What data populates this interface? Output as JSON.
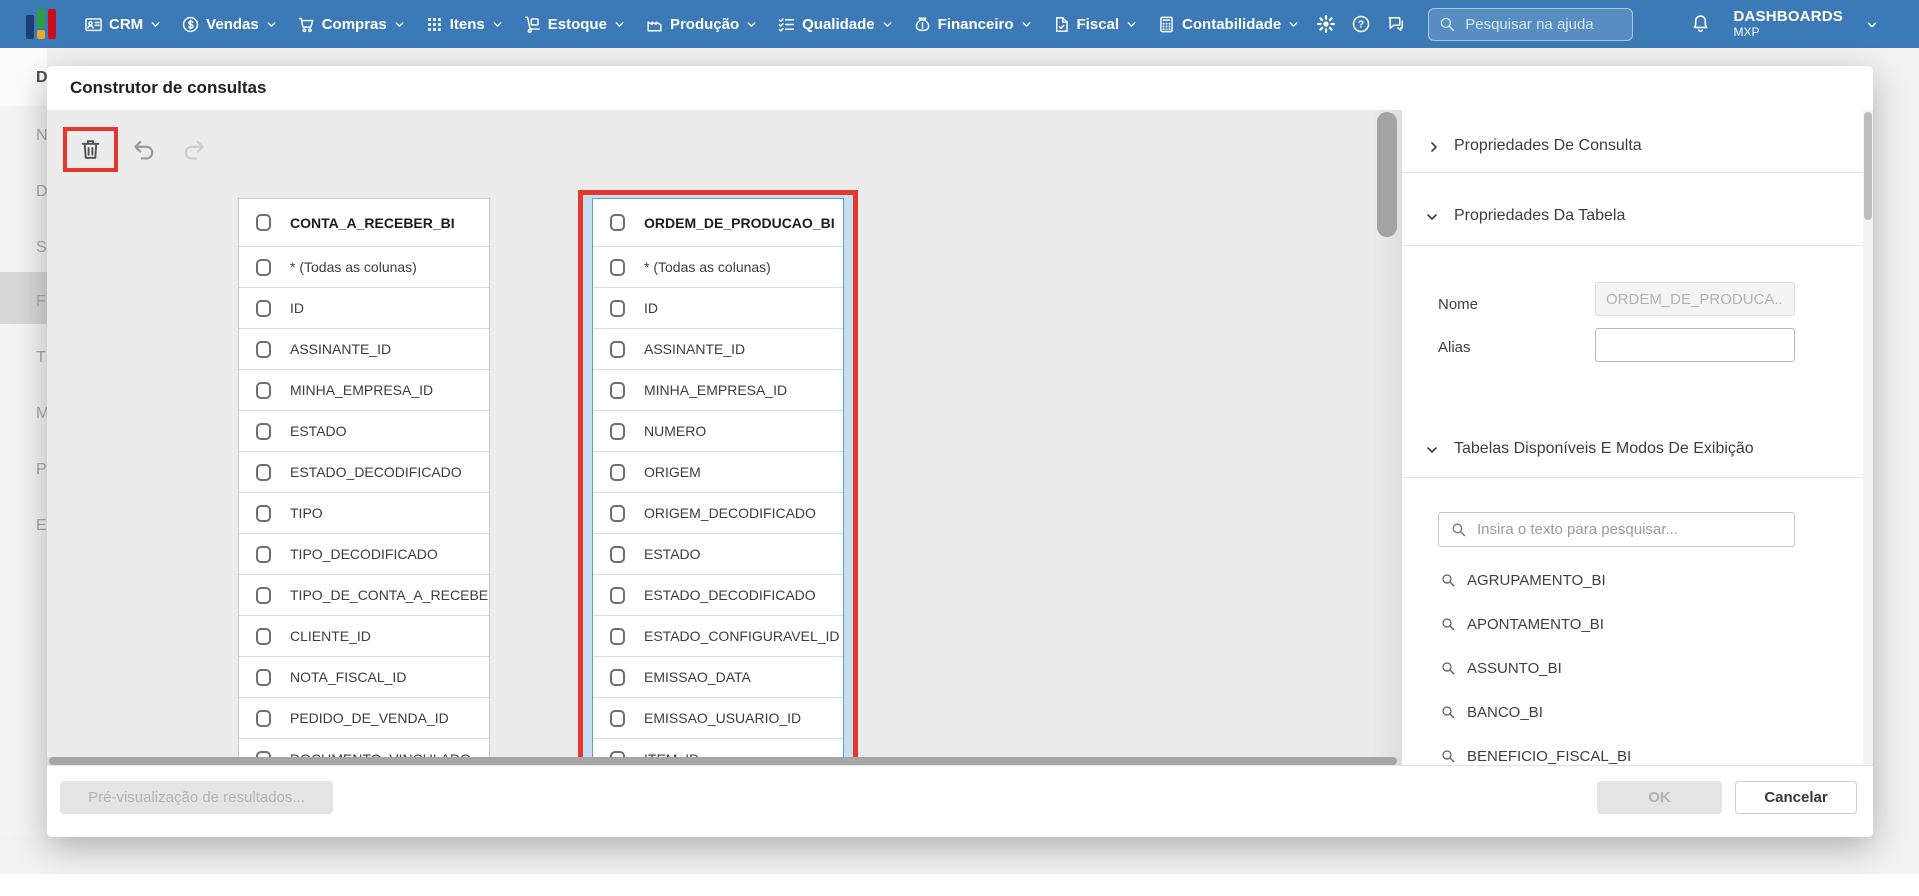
{
  "nav": {
    "logo": "mxp-logo",
    "menus": [
      {
        "id": "crm",
        "label": "CRM",
        "icon": "crm-icon"
      },
      {
        "id": "vendas",
        "label": "Vendas",
        "icon": "vendas-icon"
      },
      {
        "id": "compras",
        "label": "Compras",
        "icon": "compras-icon"
      },
      {
        "id": "itens",
        "label": "Itens",
        "icon": "itens-icon"
      },
      {
        "id": "estoque",
        "label": "Estoque",
        "icon": "estoque-icon"
      },
      {
        "id": "producao",
        "label": "Produção",
        "icon": "producao-icon"
      },
      {
        "id": "qualidade",
        "label": "Qualidade",
        "icon": "qualidade-icon"
      },
      {
        "id": "financeiro",
        "label": "Financeiro",
        "icon": "financeiro-icon"
      },
      {
        "id": "fiscal",
        "label": "Fiscal",
        "icon": "fiscal-icon"
      },
      {
        "id": "contabilidade",
        "label": "Contabilidade",
        "icon": "contabilidade-icon"
      }
    ],
    "tool_icons": [
      "gear-icon",
      "help-icon",
      "chat-icon"
    ],
    "search_placeholder": "Pesquisar na ajuda",
    "bell_icon": "bell-icon",
    "user": {
      "title": "DASHBOARDS",
      "subtitle": "MXP"
    }
  },
  "background": {
    "sidebar_letters": [
      "D",
      "N",
      "D",
      "S",
      "F",
      "T",
      "M",
      "P",
      "E"
    ],
    "highlighted_letter": "F"
  },
  "modal": {
    "title": "Construtor de consultas",
    "toolbar": {
      "icons": [
        "trash-icon",
        "undo-icon",
        "redo-icon"
      ]
    },
    "highlight_color": "#e4372e",
    "tables": [
      {
        "header": "CONTA_A_RECEBER_BI",
        "selected": false,
        "columns": [
          "* (Todas as colunas)",
          "ID",
          "ASSINANTE_ID",
          "MINHA_EMPRESA_ID",
          "ESTADO",
          "ESTADO_DECODIFICADO",
          "TIPO",
          "TIPO_DECODIFICADO",
          "TIPO_DE_CONTA_A_RECEBE...",
          "CLIENTE_ID",
          "NOTA_FISCAL_ID",
          "PEDIDO_DE_VENDA_ID",
          "DOCUMENTO_VINCULADO"
        ]
      },
      {
        "header": "ORDEM_DE_PRODUCAO_BI",
        "selected": true,
        "columns": [
          "* (Todas as colunas)",
          "ID",
          "ASSINANTE_ID",
          "MINHA_EMPRESA_ID",
          "NUMERO",
          "ORIGEM",
          "ORIGEM_DECODIFICADO",
          "ESTADO",
          "ESTADO_DECODIFICADO",
          "ESTADO_CONFIGURAVEL_ID",
          "EMISSAO_DATA",
          "EMISSAO_USUARIO_ID",
          "ITEM_ID"
        ]
      }
    ],
    "panel": {
      "sections": [
        {
          "label": "Propriedades De Consulta",
          "collapsed": true
        },
        {
          "label": "Propriedades Da Tabela",
          "collapsed": false
        },
        {
          "label": "Tabelas Disponíveis E Modos De Exibição",
          "collapsed": false
        }
      ],
      "table_properties": {
        "nome_label": "Nome",
        "nome_value": "ORDEM_DE_PRODUCA...",
        "alias_label": "Alias",
        "alias_value": ""
      },
      "search_placeholder": "Insira o texto para pesquisar...",
      "available_tables": [
        "AGRUPAMENTO_BI",
        "APONTAMENTO_BI",
        "ASSUNTO_BI",
        "BANCO_BI",
        "BENEFICIO_FISCAL_BI"
      ]
    },
    "footer": {
      "preview_label": "Pré-visualização de resultados...",
      "ok_label": "OK",
      "cancel_label": "Cancelar"
    }
  },
  "colors": {
    "nav_blue": "#3b7ab7",
    "highlight_red": "#e4372e",
    "selection_halo": "#c7ddf1",
    "selected_table_border": "#5e9fd8",
    "canvas_gray": "#ececec"
  }
}
